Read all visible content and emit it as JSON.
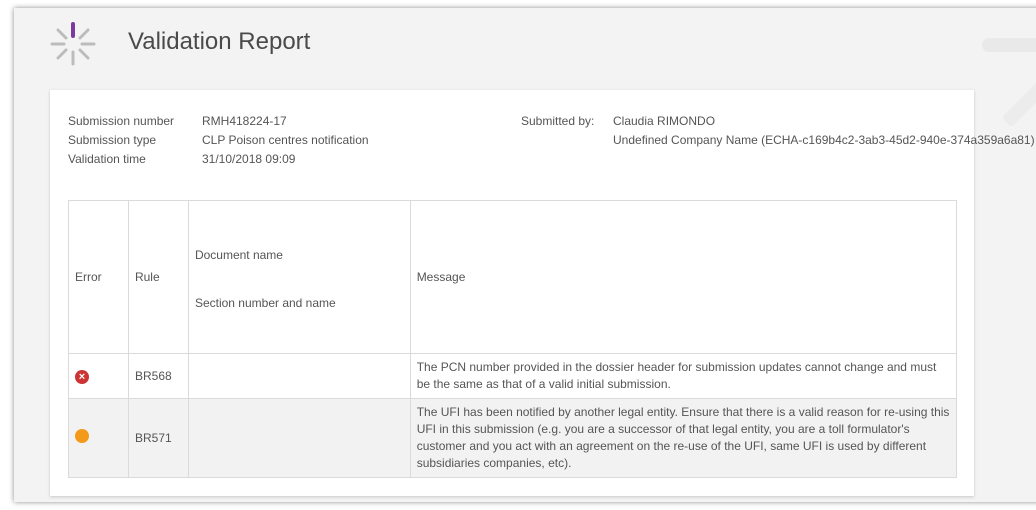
{
  "header": {
    "title": "Validation Report"
  },
  "submission": {
    "number_label": "Submission number",
    "number_value": "RMH418224-17",
    "type_label": "Submission type",
    "type_value": "CLP Poison centres notification",
    "time_label": "Validation time",
    "time_value": "31/10/2018 09:09",
    "submitted_by_label": "Submitted by:",
    "submitted_by_name": "Claudia RIMONDO",
    "submitted_by_company": "Undefined Company Name (ECHA-c169b4c2-3ab3-45d2-940e-374a359a6a81)"
  },
  "table": {
    "headers": {
      "error": "Error",
      "rule": "Rule",
      "document_name": "Document name",
      "section": "Section number and name",
      "message": "Message"
    },
    "rows": [
      {
        "severity": "error",
        "rule": "BR568",
        "document": "",
        "message": "The PCN number provided in the dossier header for submission updates cannot change and must be the same as that of a valid initial submission."
      },
      {
        "severity": "warning",
        "rule": "BR571",
        "document": "",
        "message": "The UFI has been notified by another legal entity. Ensure that there is a valid reason for re-using this UFI in this submission (e.g. you are a successor of that legal entity, you are a toll formulator's customer and you act with an agreement on the re-use of the UFI, same UFI is used by different subsidiaries companies, etc)."
      }
    ]
  },
  "colors": {
    "error": "#cc3333",
    "warning": "#f49a1a",
    "logo_purple": "#7b3aa0",
    "logo_gray": "#bcbcbc"
  }
}
